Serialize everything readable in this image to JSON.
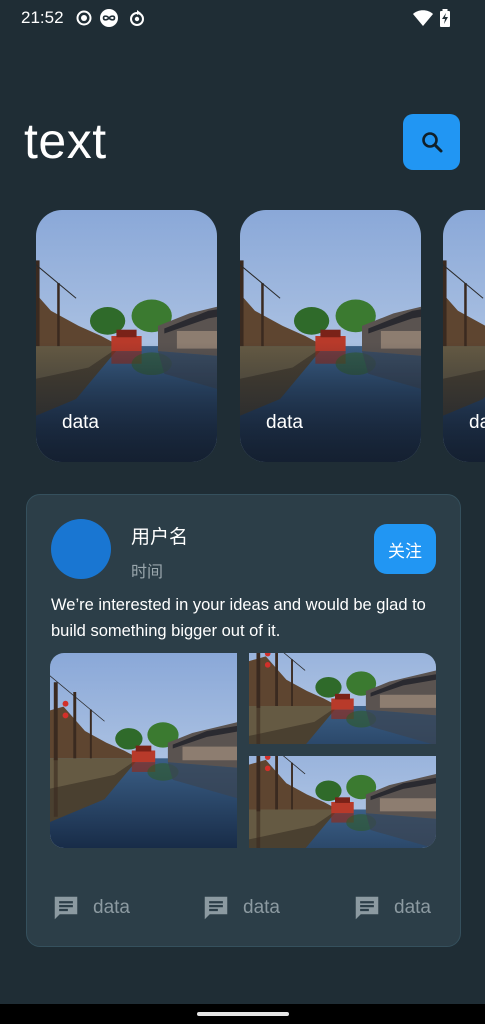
{
  "status_bar": {
    "time": "21:52",
    "icons": [
      "record-icon",
      "infinity-icon",
      "sync-icon",
      "wifi-icon",
      "battery-charging-icon"
    ]
  },
  "header": {
    "title": "text",
    "search_icon": "search-icon",
    "accent": "#2196f3"
  },
  "carousel": {
    "items": [
      {
        "label": "data"
      },
      {
        "label": "data"
      },
      {
        "label": "data"
      }
    ]
  },
  "post": {
    "username": "用户名",
    "time": "时间",
    "follow_label": "关注",
    "body": "We’re interested in your ideas and would be glad to build something bigger out of it.",
    "images": [
      "canal-town-photo",
      "canal-town-photo",
      "canal-town-photo"
    ],
    "actions": [
      {
        "icon": "comment-icon",
        "label": "data"
      },
      {
        "icon": "comment-icon",
        "label": "data"
      },
      {
        "icon": "comment-icon",
        "label": "data"
      }
    ]
  },
  "colors": {
    "background": "#1f2d35",
    "card": "#2c3e48",
    "avatar": "#1976d2",
    "muted": "#8c9aa1"
  }
}
